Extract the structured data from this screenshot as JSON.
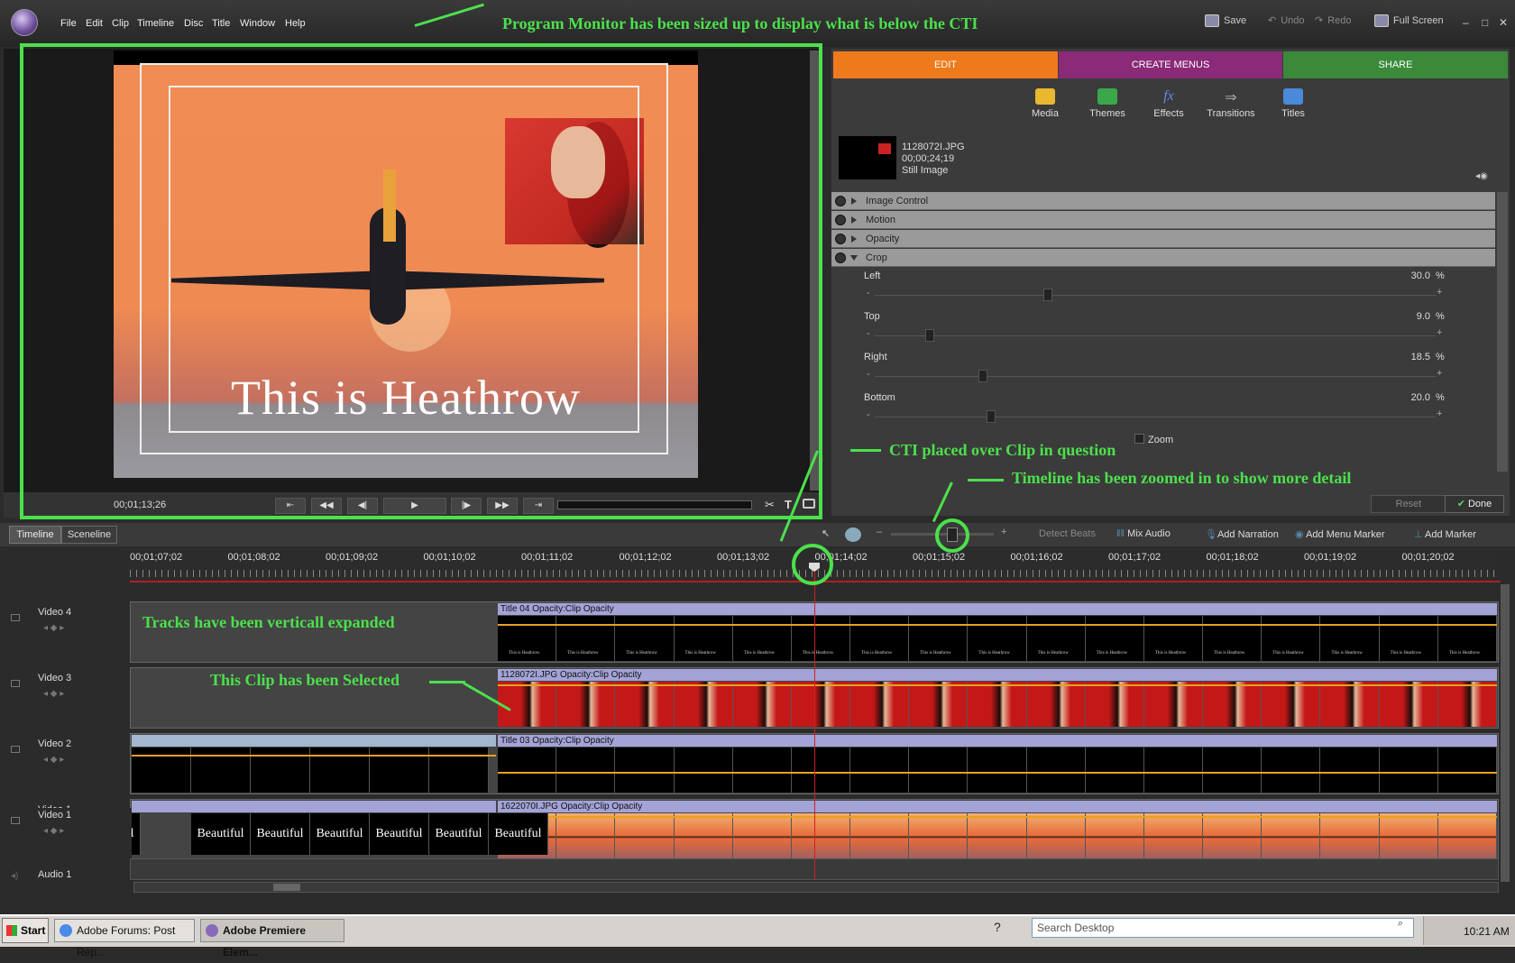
{
  "menu": [
    "File",
    "Edit",
    "Clip",
    "Timeline",
    "Disc",
    "Title",
    "Window",
    "Help"
  ],
  "toolbar": {
    "save": "Save",
    "undo": "Undo",
    "redo": "Redo",
    "fullscreen": "Full Screen"
  },
  "annotations": {
    "monitor": "Program Monitor has been sized up to display what is below the CTI",
    "cti": "CTI placed over Clip in question",
    "zoom": "Timeline has been zoomed in to show more detail",
    "tracks": "Tracks have been verticall expanded",
    "selected": "This Clip has been Selected"
  },
  "monitor": {
    "title_text": "This is Heathrow",
    "timecode": "00;01;13;26"
  },
  "tabs": {
    "edit": "EDIT",
    "menus": "CREATE MENUS",
    "share": "SHARE"
  },
  "tools": [
    "Media",
    "Themes",
    "Effects",
    "Transitions",
    "Titles"
  ],
  "clipinfo": {
    "name": "1128072I.JPG",
    "duration": "00;00;24;19",
    "type": "Still Image"
  },
  "properties": [
    "Image Control",
    "Motion",
    "Opacity",
    "Crop"
  ],
  "crop": [
    {
      "label": "Left",
      "value": "30.0",
      "pct": 0.3
    },
    {
      "label": "Top",
      "value": "9.0",
      "pct": 0.09
    },
    {
      "label": "Right",
      "value": "18.5",
      "pct": 0.185
    },
    {
      "label": "Bottom",
      "value": "20.0",
      "pct": 0.2
    }
  ],
  "pct": "%",
  "zoom_label": "Zoom",
  "reset": "Reset",
  "done": "Done",
  "tl_tabs": {
    "timeline": "Timeline",
    "sceneline": "Sceneline"
  },
  "tl_tools": {
    "detect": "Detect Beats",
    "mix": "Mix Audio",
    "narration": "Add Narration",
    "menumarker": "Add Menu Marker",
    "marker": "Add Marker"
  },
  "ticks": [
    "00;01;07;02",
    "00;01;08;02",
    "00;01;09;02",
    "00;01;10;02",
    "00;01;11;02",
    "00;01;12;02",
    "00;01;13;02",
    "00;01;14;02",
    "00;01;15;02",
    "00;01;16;02",
    "00;01;17;02",
    "00;01;18;02",
    "00;01;19;02",
    "00;01;20;02"
  ],
  "tracks": [
    {
      "label": "Video 4",
      "clip": "Title 04  Opacity:Clip Opacity"
    },
    {
      "label": "Video 3",
      "clip": "1128072I.JPG  Opacity:Clip Opacity"
    },
    {
      "label": "Video 2",
      "clip": "Title 03  Opacity:Clip Opacity"
    },
    {
      "label": "Video 1",
      "clip": "1622070I.JPG  Opacity:Clip Opacity"
    },
    {
      "label": "Audio 1",
      "clip": ""
    }
  ],
  "beautiful": "Beautiful",
  "thumb_title": "This is Heathrow",
  "taskbar": {
    "start": "Start",
    "task1": "Adobe Forums: Post Rep...",
    "task2": "Adobe Premiere Elem...",
    "search": "Search Desktop",
    "clock": "10:21 AM"
  }
}
